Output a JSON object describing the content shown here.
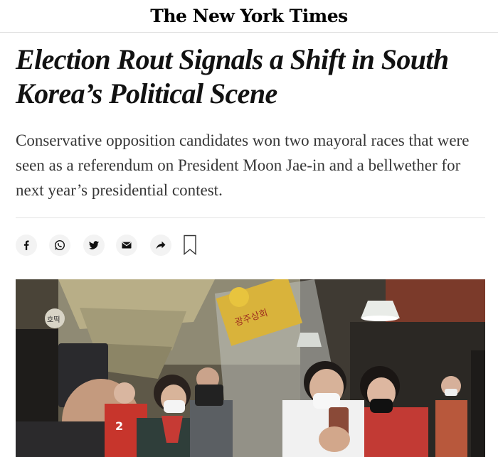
{
  "masthead": {
    "logo_text": "The New York Times"
  },
  "article": {
    "headline": "Election Rout Signals a Shift in South Korea’s Political Scene",
    "summary": "Conservative opposition candidates won two mayoral races that were seen as a referendum on President Moon Jae-in and a bellwether for next year’s presidential contest."
  },
  "share": {
    "buttons": [
      {
        "icon": "facebook-icon"
      },
      {
        "icon": "whatsapp-icon"
      },
      {
        "icon": "twitter-icon"
      },
      {
        "icon": "email-icon"
      },
      {
        "icon": "share-arrow-icon"
      },
      {
        "icon": "bookmark-icon"
      }
    ]
  },
  "photo": {
    "sign_text": "광주상회",
    "sign_text_small": "호떡",
    "campaign_number": "2"
  }
}
